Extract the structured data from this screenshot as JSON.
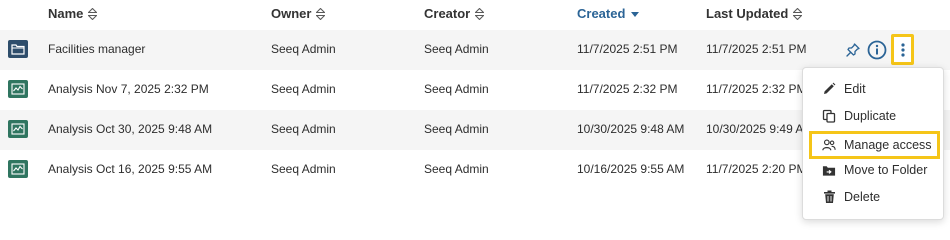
{
  "columns": {
    "name": "Name",
    "owner": "Owner",
    "creator": "Creator",
    "created": "Created",
    "last_updated": "Last Updated"
  },
  "sort": {
    "active_column": "created",
    "direction": "descending"
  },
  "rows": [
    {
      "type": "folder",
      "icon": "folder-icon",
      "name": "Facilities manager",
      "owner": "Seeq Admin",
      "creator": "Seeq Admin",
      "created": "11/7/2025 2:51 PM",
      "updated": "11/7/2025 2:51 PM"
    },
    {
      "type": "analysis",
      "icon": "analysis-icon",
      "name": "Analysis Nov 7, 2025 2:32 PM",
      "owner": "Seeq Admin",
      "creator": "Seeq Admin",
      "created": "11/7/2025 2:32 PM",
      "updated": "11/7/2025 2:32 PM"
    },
    {
      "type": "analysis",
      "icon": "analysis-icon",
      "name": "Analysis Oct 30, 2025 9:48 AM",
      "owner": "Seeq Admin",
      "creator": "Seeq Admin",
      "created": "10/30/2025 9:48 AM",
      "updated": "10/30/2025 9:49 AM"
    },
    {
      "type": "analysis",
      "icon": "analysis-icon",
      "name": "Analysis Oct 16, 2025 9:55 AM",
      "owner": "Seeq Admin",
      "creator": "Seeq Admin",
      "created": "10/16/2025 9:55 AM",
      "updated": "11/7/2025 2:20 PM"
    }
  ],
  "row_actions": {
    "pin_icon": "pin-icon",
    "info_icon": "info-icon",
    "more_icon": "more-vertical-icon"
  },
  "menu": {
    "items": [
      {
        "label": "Edit",
        "icon": "pencil-icon"
      },
      {
        "label": "Duplicate",
        "icon": "duplicate-icon"
      },
      {
        "label": "Manage access",
        "icon": "users-icon"
      },
      {
        "label": "Move to Folder",
        "icon": "move-folder-icon"
      },
      {
        "label": "Delete",
        "icon": "trash-icon"
      }
    ]
  },
  "colors": {
    "highlight": "#f5c518",
    "folder_icon_bg": "#2e4d6b",
    "analysis_icon_bg": "#2f7560",
    "active_header": "#2b6496",
    "row_stripe": "#f5f5f5"
  }
}
